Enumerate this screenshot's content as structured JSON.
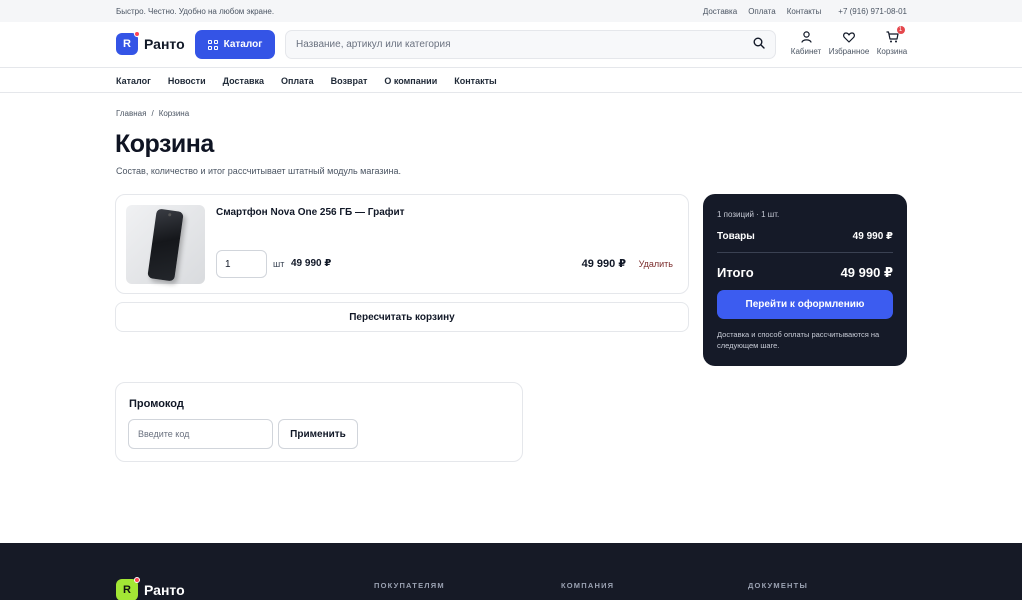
{
  "topbar": {
    "tagline": "Быстро. Честно. Удобно на любом экране.",
    "links": [
      "Доставка",
      "Оплата",
      "Контакты"
    ],
    "phone": "+7 (916) 971-08-01"
  },
  "header": {
    "logo_letter": "R",
    "logo_text": "Ранто",
    "catalog_label": "Каталог",
    "search_placeholder": "Название, артикул или категория",
    "icons": [
      {
        "name": "user-icon",
        "label": "Кабинет"
      },
      {
        "name": "heart-icon",
        "label": "Избранное"
      },
      {
        "name": "cart-icon",
        "label": "Корзина",
        "badge": "1"
      }
    ]
  },
  "nav": [
    "Каталог",
    "Новости",
    "Доставка",
    "Оплата",
    "Возврат",
    "О компании",
    "Контакты"
  ],
  "breadcrumb": {
    "home": "Главная",
    "sep": "/",
    "current": "Корзина"
  },
  "page": {
    "title": "Корзина",
    "subtitle": "Состав, количество и итог рассчитывает штатный модуль магазина."
  },
  "cart_item": {
    "name": "Смартфон Nova One 256 ГБ — Графит",
    "qty": "1",
    "unit": "шт",
    "unit_price": "49 990 ₽",
    "total": "49 990 ₽",
    "remove_label": "Удалить"
  },
  "recalc_label": "Пересчитать корзину",
  "summary": {
    "count": "1 позиций · 1 шт.",
    "goods_label": "Товары",
    "goods_value": "49 990 ₽",
    "total_label": "Итого",
    "total_value": "49 990 ₽",
    "checkout_label": "Перейти к оформлению",
    "note": "Доставка и способ оплаты рассчитываются на следующем шаге."
  },
  "promo": {
    "title": "Промокод",
    "placeholder": "Введите код",
    "apply_label": "Применить"
  },
  "footer": {
    "logo_letter": "R",
    "logo_text": "Ранто",
    "columns": [
      "ПОКУПАТЕЛЯМ",
      "КОМПАНИЯ",
      "ДОКУМЕНТЫ"
    ]
  },
  "colors": {
    "accent": "#3454e6",
    "summary_bg": "#151a28",
    "footer_bg": "#161a26",
    "badge": "#e5484d",
    "footer_logo": "#a3e635"
  }
}
